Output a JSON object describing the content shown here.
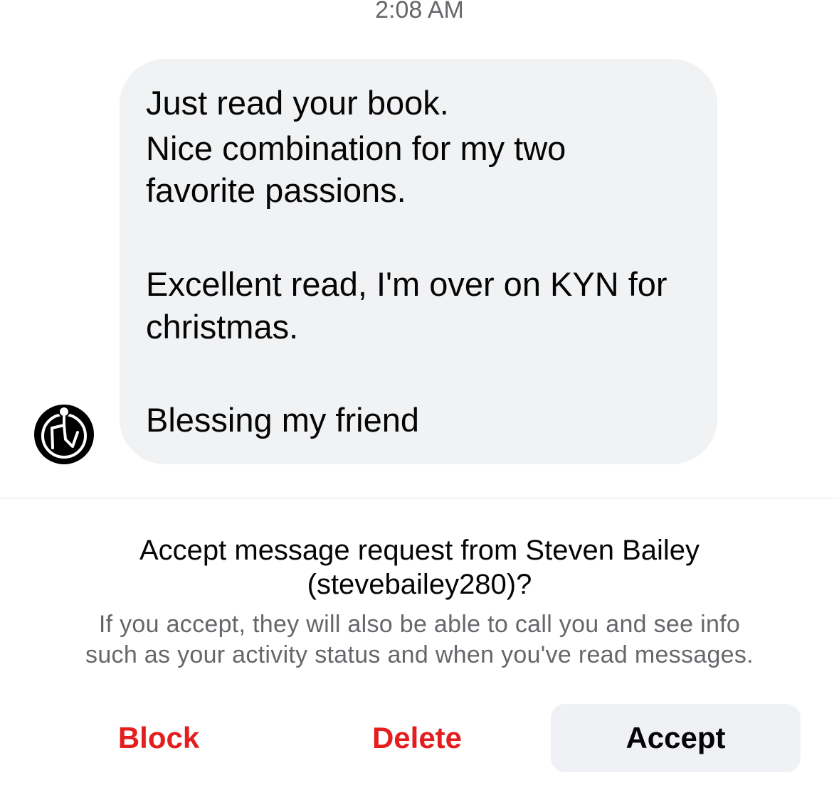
{
  "timestamp": "2:08 AM",
  "message": {
    "lines": [
      "Just read your book.",
      "Nice combination for my two",
      "favorite passions.",
      "Excellent read, I'm over on KYN for",
      "christmas.",
      "Blessing my friend"
    ]
  },
  "sender_avatar": {
    "icon": "logo-avatar-icon"
  },
  "request": {
    "title_line1": "Accept message request from Steven Bailey",
    "title_line2": "(stevebailey280)?",
    "sub_line1": "If you accept, they will also be able to call you and see info",
    "sub_line2": "such as your activity status and when you've read messages."
  },
  "actions": {
    "block": "Block",
    "delete": "Delete",
    "accept": "Accept"
  },
  "colors": {
    "danger": "#e41e1e",
    "bubble_bg": "#f1f2f4",
    "muted_text": "#65676b",
    "accept_bg": "#eff1f4"
  }
}
